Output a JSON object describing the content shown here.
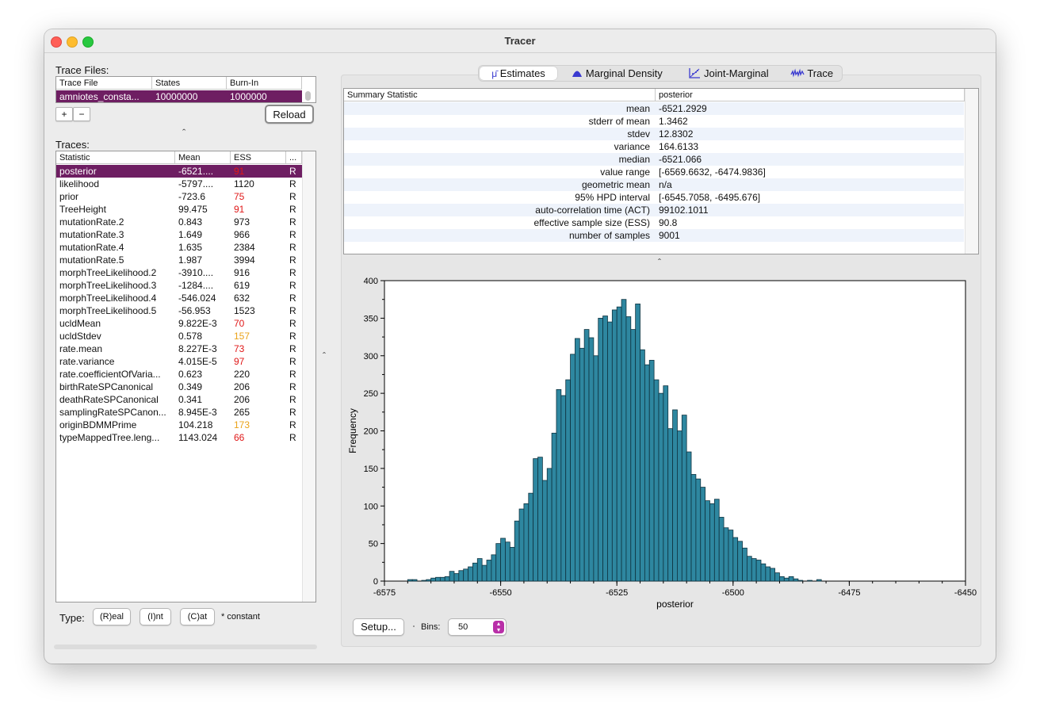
{
  "window": {
    "title": "Tracer"
  },
  "trace_files": {
    "label": "Trace Files:",
    "columns": [
      "Trace File",
      "States",
      "Burn-In"
    ],
    "rows": [
      {
        "file": "amniotes_consta...",
        "states": "10000000",
        "burnin": "1000000"
      }
    ],
    "add_label": "+",
    "remove_label": "−",
    "reload_label": "Reload"
  },
  "splitter_glyph": "ˆ",
  "traces": {
    "label": "Traces:",
    "columns": [
      "Statistic",
      "Mean",
      "ESS",
      "..."
    ],
    "rows": [
      {
        "stat": "posterior",
        "mean": "-6521....",
        "ess": "91",
        "ess_color": "red",
        "type": "R"
      },
      {
        "stat": "likelihood",
        "mean": "-5797....",
        "ess": "1120",
        "ess_color": "",
        "type": "R"
      },
      {
        "stat": "prior",
        "mean": "-723.6",
        "ess": "75",
        "ess_color": "red",
        "type": "R"
      },
      {
        "stat": "TreeHeight",
        "mean": "99.475",
        "ess": "91",
        "ess_color": "red",
        "type": "R"
      },
      {
        "stat": "mutationRate.2",
        "mean": "0.843",
        "ess": "973",
        "ess_color": "",
        "type": "R"
      },
      {
        "stat": "mutationRate.3",
        "mean": "1.649",
        "ess": "966",
        "ess_color": "",
        "type": "R"
      },
      {
        "stat": "mutationRate.4",
        "mean": "1.635",
        "ess": "2384",
        "ess_color": "",
        "type": "R"
      },
      {
        "stat": "mutationRate.5",
        "mean": "1.987",
        "ess": "3994",
        "ess_color": "",
        "type": "R"
      },
      {
        "stat": "morphTreeLikelihood.2",
        "mean": "-3910....",
        "ess": "916",
        "ess_color": "",
        "type": "R"
      },
      {
        "stat": "morphTreeLikelihood.3",
        "mean": "-1284....",
        "ess": "619",
        "ess_color": "",
        "type": "R"
      },
      {
        "stat": "morphTreeLikelihood.4",
        "mean": "-546.024",
        "ess": "632",
        "ess_color": "",
        "type": "R"
      },
      {
        "stat": "morphTreeLikelihood.5",
        "mean": "-56.953",
        "ess": "1523",
        "ess_color": "",
        "type": "R"
      },
      {
        "stat": "ucldMean",
        "mean": "9.822E-3",
        "ess": "70",
        "ess_color": "red",
        "type": "R"
      },
      {
        "stat": "ucldStdev",
        "mean": "0.578",
        "ess": "157",
        "ess_color": "orange",
        "type": "R"
      },
      {
        "stat": "rate.mean",
        "mean": "8.227E-3",
        "ess": "73",
        "ess_color": "red",
        "type": "R"
      },
      {
        "stat": "rate.variance",
        "mean": "4.015E-5",
        "ess": "97",
        "ess_color": "red",
        "type": "R"
      },
      {
        "stat": "rate.coefficientOfVaria...",
        "mean": "0.623",
        "ess": "220",
        "ess_color": "",
        "type": "R"
      },
      {
        "stat": "birthRateSPCanonical",
        "mean": "0.349",
        "ess": "206",
        "ess_color": "",
        "type": "R"
      },
      {
        "stat": "deathRateSPCanonical",
        "mean": "0.341",
        "ess": "206",
        "ess_color": "",
        "type": "R"
      },
      {
        "stat": "samplingRateSPCanon...",
        "mean": "8.945E-3",
        "ess": "265",
        "ess_color": "",
        "type": "R"
      },
      {
        "stat": "originBDMMPrime",
        "mean": "104.218",
        "ess": "173",
        "ess_color": "orange",
        "type": "R"
      },
      {
        "stat": "typeMappedTree.leng...",
        "mean": "1143.024",
        "ess": "66",
        "ess_color": "red",
        "type": "R"
      }
    ]
  },
  "type_bar": {
    "label": "Type:",
    "real_label": "(R)eal",
    "int_label": "(I)nt",
    "cat_label": "(C)at",
    "constant_note": "* constant"
  },
  "tabs": [
    {
      "label": "Estimates",
      "icon": "mu-icon",
      "active": true
    },
    {
      "label": "Marginal Density",
      "icon": "density-icon",
      "active": false
    },
    {
      "label": "Joint-Marginal",
      "icon": "joint-marginal-icon",
      "active": false
    },
    {
      "label": "Trace",
      "icon": "trace-icon",
      "active": false
    }
  ],
  "summary": {
    "header_stat": "Summary Statistic",
    "header_val": "posterior",
    "rows": [
      {
        "k": "mean",
        "v": "-6521.2929"
      },
      {
        "k": "stderr of mean",
        "v": "1.3462"
      },
      {
        "k": "stdev",
        "v": "12.8302"
      },
      {
        "k": "variance",
        "v": "164.6133"
      },
      {
        "k": "median",
        "v": "-6521.066"
      },
      {
        "k": "value range",
        "v": "[-6569.6632, -6474.9836]"
      },
      {
        "k": "geometric mean",
        "v": "n/a"
      },
      {
        "k": "95% HPD interval",
        "v": "[-6545.7058, -6495.676]"
      },
      {
        "k": "auto-correlation time (ACT)",
        "v": "99102.1011"
      },
      {
        "k": "effective sample size (ESS)",
        "v": "90.8"
      },
      {
        "k": "number of samples",
        "v": "9001"
      }
    ]
  },
  "chart_data": {
    "type": "bar",
    "xlabel": "posterior",
    "ylabel": "Frequency",
    "xlim": [
      -6575,
      -6450
    ],
    "ylim": [
      0,
      400
    ],
    "xticks": [
      "-6575",
      "-6550",
      "-6525",
      "-6500",
      "-6475",
      "-6450"
    ],
    "yticks": [
      "0",
      "50",
      "100",
      "150",
      "200",
      "250",
      "300",
      "350",
      "400"
    ],
    "bin_start": -6570,
    "bin_width": 1,
    "values": [
      2,
      2,
      0,
      1,
      2,
      4,
      5,
      5,
      6,
      13,
      10,
      14,
      16,
      19,
      24,
      30,
      21,
      28,
      35,
      50,
      57,
      52,
      45,
      80,
      96,
      103,
      117,
      163,
      165,
      134,
      150,
      197,
      255,
      247,
      268,
      302,
      323,
      310,
      335,
      324,
      300,
      350,
      353,
      345,
      361,
      365,
      375,
      352,
      335,
      369,
      308,
      288,
      294,
      268,
      250,
      260,
      203,
      228,
      200,
      221,
      172,
      142,
      136,
      125,
      107,
      103,
      109,
      85,
      71,
      68,
      58,
      53,
      44,
      33,
      30,
      28,
      23,
      19,
      17,
      11,
      6,
      4,
      6,
      3,
      1,
      0,
      1,
      0,
      2,
      0
    ]
  },
  "chart_controls": {
    "setup_label": "Setup...",
    "bins_label": "Bins:",
    "bins_value": "50"
  },
  "colors": {
    "selection": "#6e1e62",
    "bar_fill": "#2e87a0",
    "ess_red": "#e01818",
    "ess_orange": "#eaa31a"
  }
}
